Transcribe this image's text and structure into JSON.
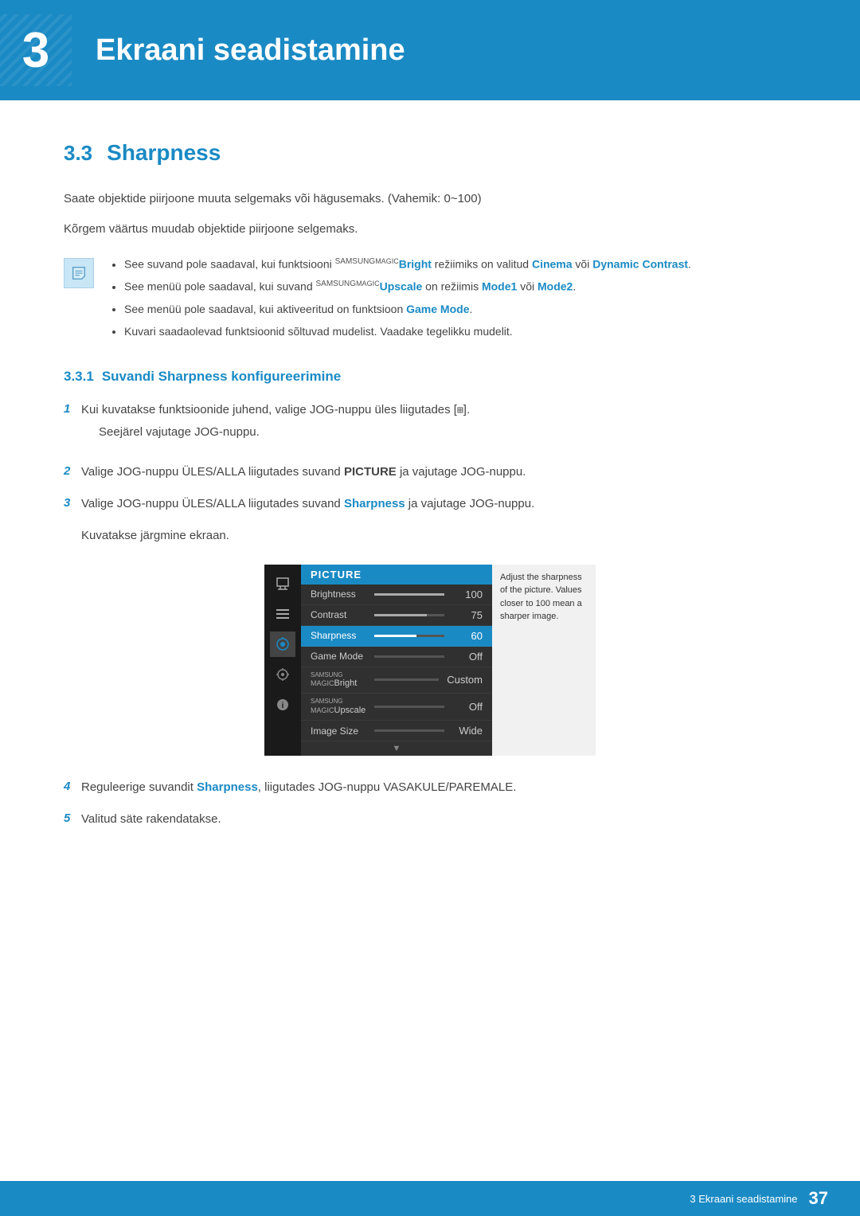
{
  "chapter": {
    "number": "3",
    "title": "Ekraani seadistamine"
  },
  "section": {
    "number": "3.3",
    "title": "Sharpness"
  },
  "body_text_1": "Saate objektide piirjoone muuta selgemaks või hägusemaks. (Vahemik: 0~100)",
  "body_text_2": "Kõrgem väärtus muudab objektide piirjoone selgemaks.",
  "notes": [
    {
      "text_before": "See suvand pole saadaval, kui funktsiooni ",
      "brand1": "SAMSUNG",
      "brand2": "MAGIC",
      "brand_label": "Bright",
      "text_mid": " režiimiks on valitud ",
      "highlight1": "Cinema",
      "text_mid2": " või ",
      "highlight2": "Dynamic Contrast",
      "text_after": "."
    },
    {
      "text_before": "See menüü pole saadaval, kui suvand ",
      "brand1": "SAMSUNG",
      "brand2": "MAGIC",
      "brand_label": "Upscale",
      "text_mid": " on režiimis ",
      "highlight1": "Mode1",
      "text_mid2": " või ",
      "highlight2": "Mode2",
      "text_after": "."
    },
    {
      "text_before": "See menüü pole saadaval, kui aktiveeritud on funktsioon ",
      "highlight1": "Game Mode",
      "text_after": "."
    },
    {
      "text_plain": "Kuvari saadaolevad funktsioonid sõltuvad mudelist. Vaadake tegelikku mudelit."
    }
  ],
  "subsection": {
    "number": "3.3.1",
    "title": "Suvandi Sharpness konfigureerimine"
  },
  "steps": [
    {
      "num": "1",
      "text": "Kui kuvatakse funktsioonide juhend, valige JOG-nuppu üles liigutades [⊞].",
      "sub": "Seejärel vajutage JOG-nuppu."
    },
    {
      "num": "2",
      "text_before": "Valige JOG-nuppu ÜLES/ALLA liigutades suvand ",
      "highlight": "PICTURE",
      "text_after": " ja vajutage JOG-nuppu."
    },
    {
      "num": "3",
      "text_before": "Valige JOG-nuppu ÜLES/ALLA liigutades suvand ",
      "highlight": "Sharpness",
      "text_after": " ja vajutage JOG-nuppu.",
      "sub": "Kuvatakse järgmine ekraan."
    },
    {
      "num": "4",
      "text_before": "Reguleerige suvandit ",
      "highlight": "Sharpness",
      "text_after": ", liigutades JOG-nuppu VASAKULE/PAREMALE."
    },
    {
      "num": "5",
      "text": "Valitud säte rakendatakse."
    }
  ],
  "osd": {
    "header": "PICTURE",
    "items": [
      {
        "label": "Brightness",
        "value": "100",
        "bar_pct": 100
      },
      {
        "label": "Contrast",
        "value": "75",
        "bar_pct": 75
      },
      {
        "label": "Sharpness",
        "value": "60",
        "bar_pct": 60,
        "selected": true
      },
      {
        "label": "Game Mode",
        "value": "Off",
        "bar_pct": 0,
        "no_bar": true
      },
      {
        "label": "SAMSUNGMAGICBright",
        "label_display": "SAMSUNG\nMAGICBright",
        "value": "Custom",
        "bar_pct": 0,
        "no_bar": true
      },
      {
        "label": "SAMSUNGMAGICUpscale",
        "label_display": "SAMSUNG\nMAGICUpscale",
        "value": "Off",
        "bar_pct": 0,
        "no_bar": true
      },
      {
        "label": "Image Size",
        "value": "Wide",
        "bar_pct": 0,
        "no_bar": true
      }
    ],
    "tooltip": "Adjust the sharpness of the picture. Values closer to 100 mean a sharper image."
  },
  "footer": {
    "text": "3 Ekraani seadistamine",
    "page": "37"
  }
}
